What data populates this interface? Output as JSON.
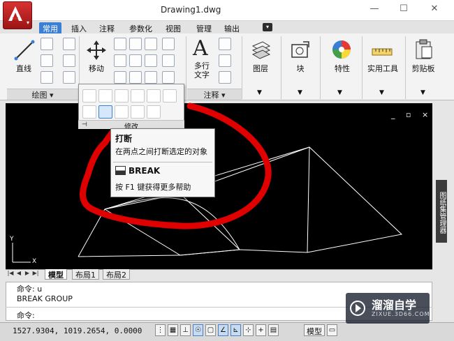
{
  "window": {
    "title": "Drawing1.dwg"
  },
  "tabs": [
    "常用",
    "插入",
    "注释",
    "参数化",
    "视图",
    "管理",
    "输出"
  ],
  "ribbon": {
    "draw": {
      "line_label": "直线",
      "panel_label": "绘图 ▾"
    },
    "modify": {
      "move_label": "移动",
      "panel_label": "修改"
    },
    "annotation": {
      "mtext_label": "多行\n文字",
      "panel_label": "注释 ▾"
    },
    "layers_label": "图层",
    "block_label": "块",
    "properties_label": "特性",
    "utilities_label": "实用工具",
    "clipboard_label": "剪贴板"
  },
  "tooltip": {
    "title": "打断",
    "description": "在两点之间打断选定的对象",
    "command": "BREAK",
    "help": "按 F1 键获得更多帮助"
  },
  "canvas_controls": "_ ▫ ×",
  "right_palette_label": "图纸集管理器",
  "ucs": {
    "x_label": "X",
    "y_label": "Y"
  },
  "layout_tabs": [
    "模型",
    "布局1",
    "布局2"
  ],
  "command_window": {
    "history": [
      "命令: u",
      "BREAK GROUP"
    ],
    "prompt": "命令:"
  },
  "status": {
    "coords": "1527.9304, 1019.2654, 0.0000",
    "model_label": "模型"
  },
  "watermark": {
    "brand": "溜溜自学",
    "url": "ZIXUE.3D66.COM"
  },
  "colors": {
    "accent": "#3a7fd4",
    "annotation_red": "#e00000",
    "canvas": "#000000",
    "app_button": "#c62828"
  }
}
